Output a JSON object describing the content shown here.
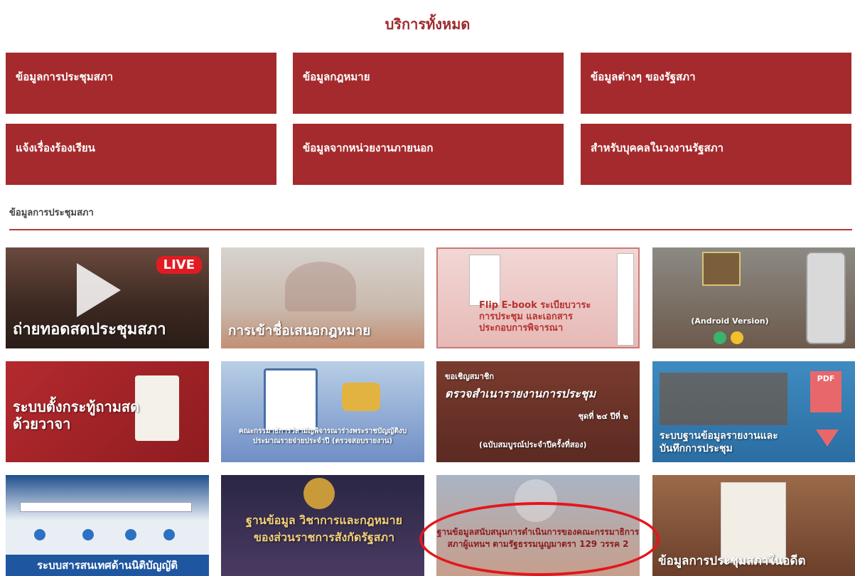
{
  "page": {
    "title": "บริการทั้งหมด"
  },
  "categories": [
    "ข้อมูลการประชุมสภา",
    "ข้อมูลกฎหมาย",
    "ข้อมูลต่างๆ ของรัฐสภา",
    "แจ้งเรื่องร้องเรียน",
    "ข้อมูลจากหน่วยงานภายนอก",
    "สำหรับบุคคลในวงงานรัฐสภา"
  ],
  "section": {
    "label": "ข้อมูลการประชุมสภา"
  },
  "tiles": [
    {
      "caption": "ถ่ายทอดสดประชุมสภา",
      "badge": "LIVE"
    },
    {
      "caption": "การเข้าชื่อเสนอกฎหมาย"
    },
    {
      "caption": "Flip E-book ระเบียบวาระการประชุม และเอกสารประกอบการพิจารณา"
    },
    {
      "caption": "(Android Version)"
    },
    {
      "caption": "ระบบตั้งกระทู้ถามสดด้วยวาจา"
    },
    {
      "caption": "คณะกรรมาธิการวิสามัญพิจารณาร่างพระราชบัญญัติงบประมาณรายจ่ายประจำปี (ตรวจสอบรายงาน)"
    },
    {
      "kicker": "ขอเชิญสมาชิก",
      "caption": "ตรวจสำเนารายงานการประชุม",
      "sub1": "ชุดที่ ๒๔ ปีที่ ๒",
      "sub2": "(ฉบับสมบูรณ์ประจำปีครั้งที่สอง)"
    },
    {
      "caption": "ระบบฐานข้อมูลรายงานและบันทึกการประชุม",
      "badge": "PDF"
    },
    {
      "caption": "ระบบสารสนเทศด้านนิติบัญญัติ"
    },
    {
      "caption": "ฐานข้อมูล วิชาการและกฎหมาย ของส่วนราชการสังกัดรัฐสภา"
    },
    {
      "caption": "ฐานข้อมูลสนับสนุนการดำเนินการของคณะกรรมาธิการ สภาผู้แทนฯ ตามรัฐธรรมนูญมาตรา 129 วรรค 2"
    },
    {
      "caption": "ข้อมูลการประชุมสภาในอดีต"
    }
  ],
  "colors": {
    "accent": "#a52a2d",
    "highlight": "#e3161d"
  }
}
